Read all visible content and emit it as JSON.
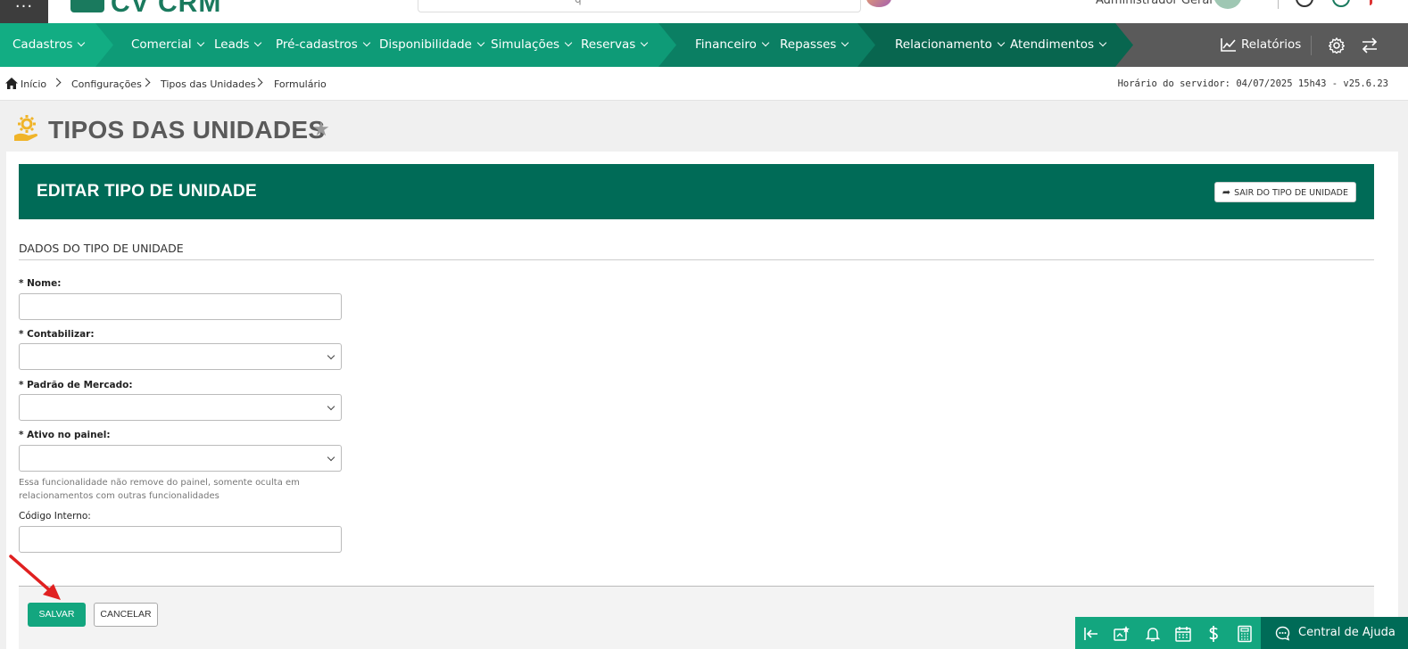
{
  "topbar": {
    "logo_text": "CV CRM",
    "search_hint": "q",
    "user_name": "Administrador Geral"
  },
  "nav": {
    "items": [
      {
        "label": "Cadastros"
      },
      {
        "label": "Comercial"
      },
      {
        "label": "Leads"
      },
      {
        "label": "Pré-cadastros"
      },
      {
        "label": "Disponibilidade"
      },
      {
        "label": "Simulações"
      },
      {
        "label": "Reservas"
      },
      {
        "label": "Financeiro"
      },
      {
        "label": "Repasses"
      },
      {
        "label": "Relacionamento"
      },
      {
        "label": "Atendimentos"
      }
    ],
    "reports_label": "Relatórios",
    "colors": {
      "seg1": "#12ad83",
      "seg2": "#0e9b77",
      "seg3": "#0b7f63",
      "seg4": "#08664f",
      "bar": "#5a5a5a"
    }
  },
  "breadcrumb": {
    "items": [
      {
        "label": "Início"
      },
      {
        "label": "Configurações"
      },
      {
        "label": "Tipos das Unidades"
      },
      {
        "label": "Formulário"
      }
    ],
    "server_time": "Horário do servidor: 04/07/2025 15h43 - v25.6.23"
  },
  "page": {
    "title": "TIPOS DAS UNIDADES"
  },
  "card": {
    "header_title": "EDITAR TIPO DE UNIDADE",
    "exit_button": "SAIR DO TIPO DE UNIDADE",
    "section_title": "DADOS DO TIPO DE UNIDADE",
    "fields": {
      "nome_label": "* Nome:",
      "nome_value": "",
      "contabilizar_label": "* Contabilizar:",
      "contabilizar_value": "",
      "padrao_label": "* Padrão de Mercado:",
      "padrao_value": "",
      "ativo_label": "* Ativo no painel:",
      "ativo_value": "",
      "ativo_help": "Essa funcionalidade não remove do painel, somente oculta em relacionamentos com outras funcionalidades",
      "codigo_label": "Código Interno:",
      "codigo_value": ""
    },
    "save_button": "SALVAR",
    "cancel_button": "CANCELAR"
  },
  "bottom_bar": {
    "help_center": "Central de Ajuda",
    "icons": [
      "collapse-left-icon",
      "calendar-star-icon",
      "bell-icon",
      "calendar-icon",
      "dollar-icon",
      "calculator-icon"
    ]
  },
  "accent": "#006b57",
  "annotation_color": "#e02020"
}
